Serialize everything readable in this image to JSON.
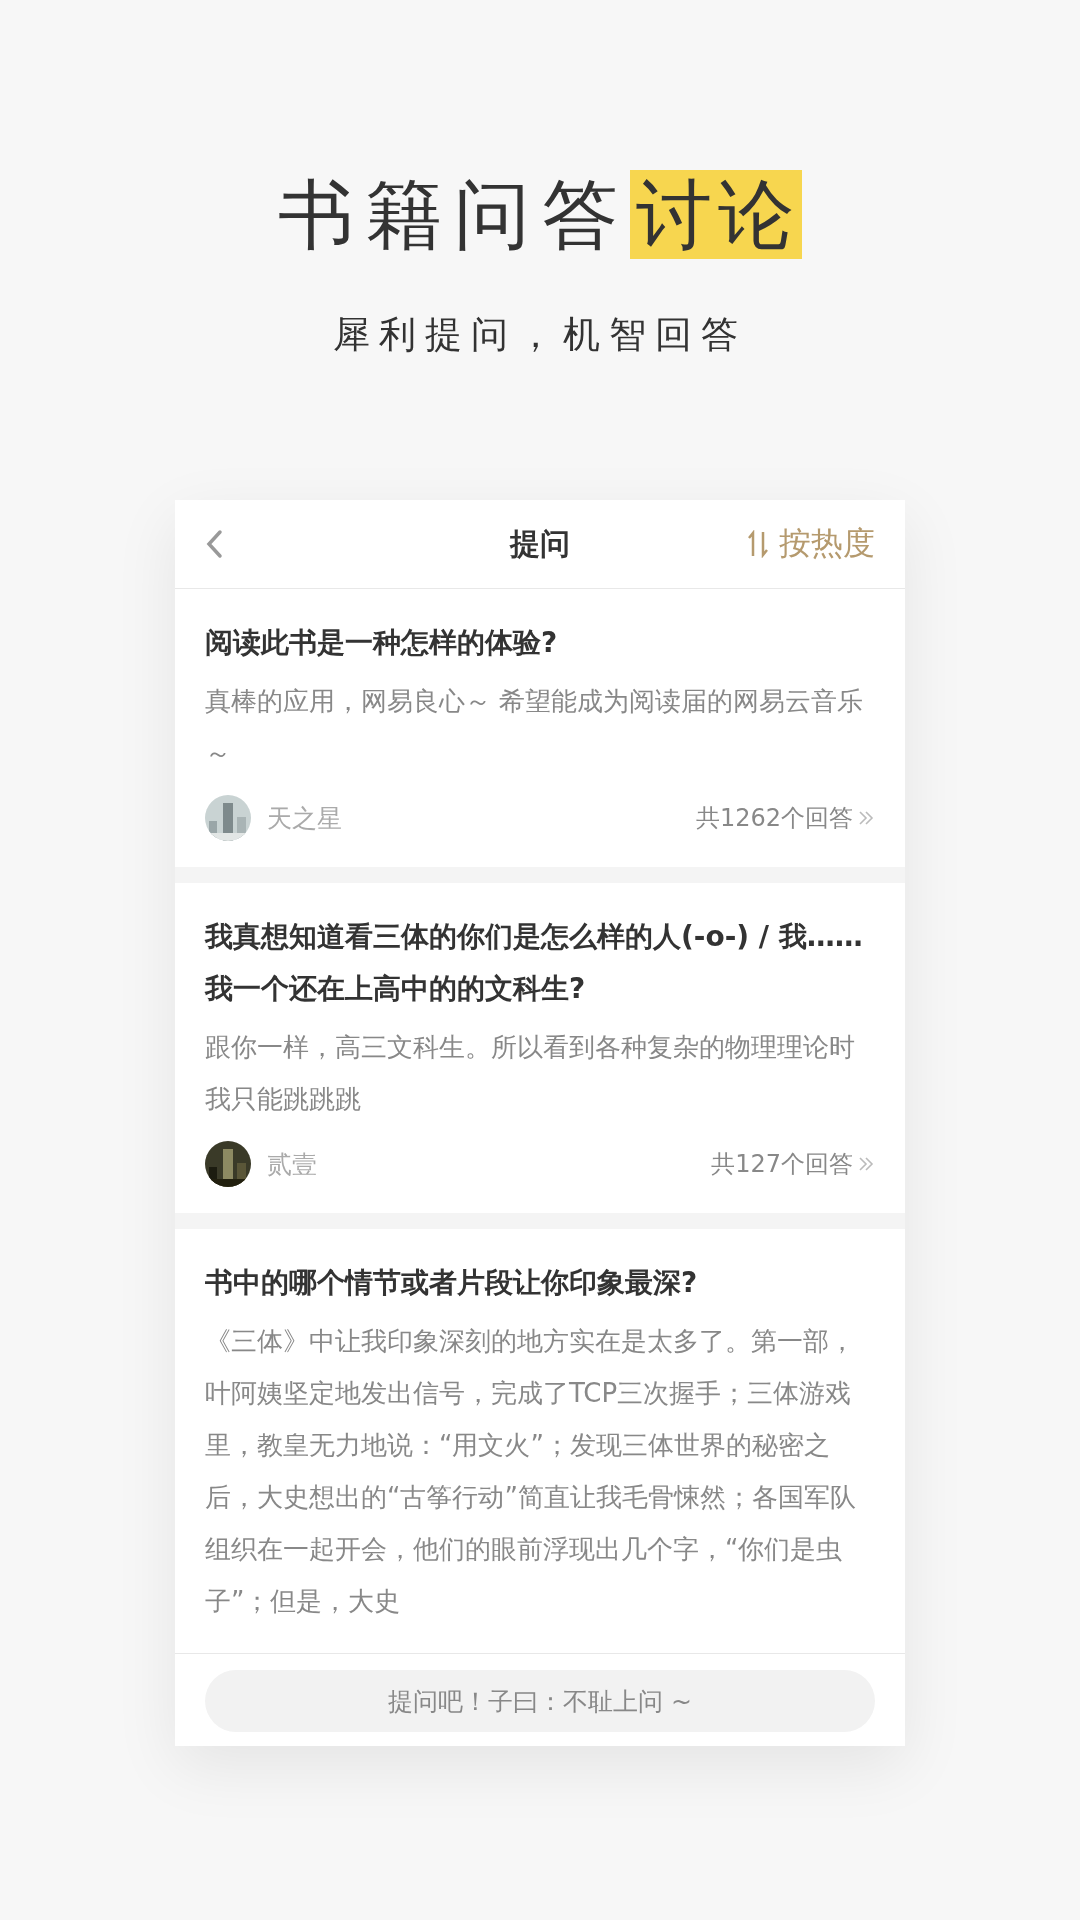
{
  "headline": {
    "text": "书籍问答",
    "highlight": "讨论"
  },
  "subtitle": "犀利提问，机智回答",
  "screen": {
    "header": {
      "title": "提问",
      "sort": "按热度"
    },
    "questions": [
      {
        "title": "阅读此书是一种怎样的体验?",
        "answer": "真棒的应用，网易良心～ 希望能成为阅读届的网易云音乐～",
        "author": "天之星",
        "count": "共1262个回答"
      },
      {
        "title": "我真想知道看三体的你们是怎么样的人(-o-) / 我……我一个还在上高中的的文科生?",
        "answer": "跟你一样，高三文科生。所以看到各种复杂的物理理论时我只能跳跳跳",
        "author": "贰壹",
        "count": "共127个回答"
      },
      {
        "title": "书中的哪个情节或者片段让你印象最深?",
        "answer": "《三体》中让我印象深刻的地方实在是太多了。第一部，叶阿姨坚定地发出信号，完成了TCP三次握手；三体游戏里，教皇无力地说：“用文火”；发现三体世界的秘密之后，大史想出的“古筝行动”简直让我毛骨悚然；各国军队组织在一起开会，他们的眼前浮现出几个字，“你们是虫子”；但是，大史"
      }
    ],
    "ask_placeholder": "提问吧！子曰：不耻上问 ~"
  }
}
